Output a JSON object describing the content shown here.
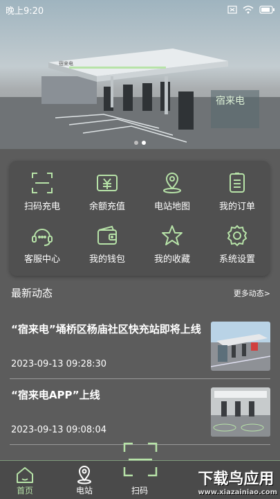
{
  "status": {
    "time": "晚上9:20"
  },
  "banner": {
    "sign_text": "宿来电"
  },
  "menu": [
    {
      "label": "扫码充电",
      "icon": "scan-icon"
    },
    {
      "label": "余额充值",
      "icon": "wallet-yen-icon"
    },
    {
      "label": "电站地图",
      "icon": "map-pin-icon"
    },
    {
      "label": "我的订单",
      "icon": "order-list-icon"
    },
    {
      "label": "客服中心",
      "icon": "headset-icon"
    },
    {
      "label": "我的钱包",
      "icon": "wallet-icon"
    },
    {
      "label": "我的收藏",
      "icon": "star-icon"
    },
    {
      "label": "系统设置",
      "icon": "gear-icon"
    }
  ],
  "news": {
    "title": "最新动态",
    "more": "更多动态>",
    "items": [
      {
        "title": "“宿来电”埇桥区杨庙社区快充站即将上线",
        "time": "2023-09-13 09:28:30"
      },
      {
        "title": "“宿来电APP”上线",
        "time": "2023-09-13 09:08:04"
      }
    ]
  },
  "tabs": {
    "home": "首页",
    "station": "电站",
    "scan": "扫码"
  },
  "watermark": {
    "main": "下载鸟应用",
    "sub": "www.xiazainiao.com"
  },
  "colors": {
    "accent": "#b7e3a8",
    "panel": "#505050"
  }
}
